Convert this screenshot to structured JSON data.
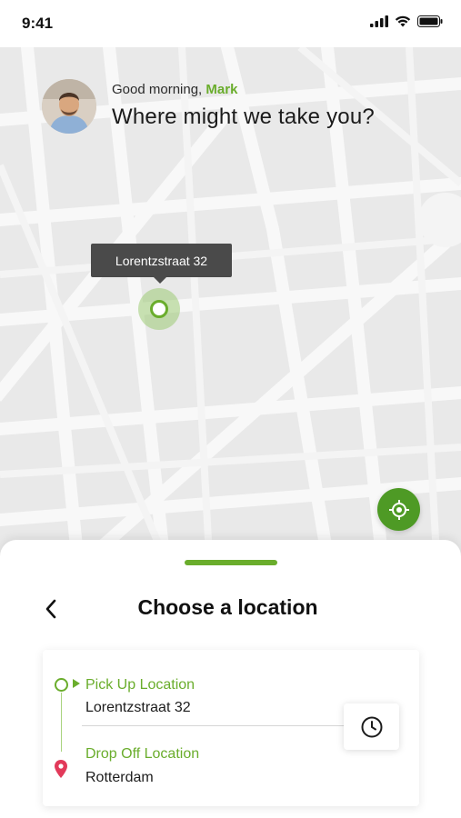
{
  "status_bar": {
    "time": "9:41"
  },
  "greeting": {
    "salutation": "Good morning,",
    "name": "Mark",
    "title": "Where might we take you?"
  },
  "map": {
    "pin_label": "Lorentzstraat 32",
    "locate_icon": "crosshair-icon"
  },
  "sheet": {
    "title": "Choose a location",
    "back_icon": "chevron-left-icon"
  },
  "route": {
    "pickup_label": "Pick Up Location",
    "pickup_value": "Lorentzstraat 32",
    "dropoff_label": "Drop Off Location",
    "dropoff_value": "Rotterdam",
    "schedule_icon": "clock-icon"
  },
  "colors": {
    "accent": "#6aad2c",
    "accent_dark": "#4e9a25",
    "tooltip": "#4a4a4a",
    "dropoff_pin": "#e23a5a",
    "map_bg": "#e9e9e9"
  }
}
